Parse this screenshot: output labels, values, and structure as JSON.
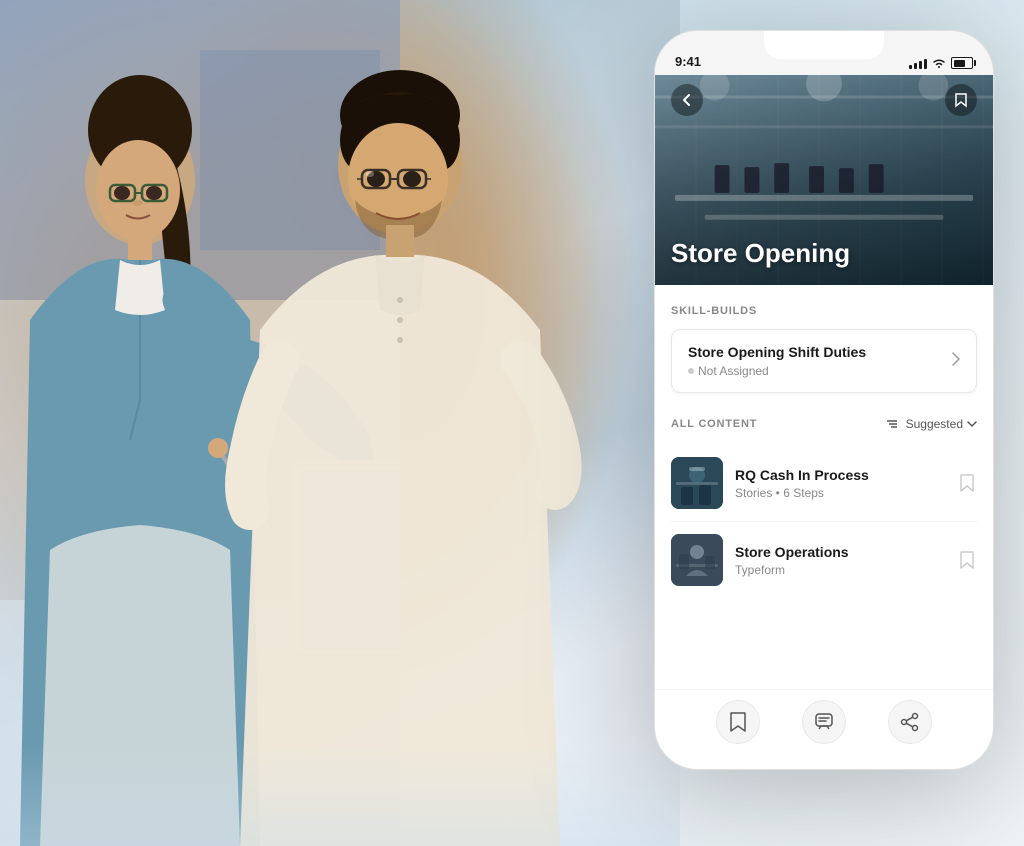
{
  "background": {
    "gradient_start": "#b0c8dc",
    "gradient_end": "#e8f0f5"
  },
  "phone": {
    "status_bar": {
      "time": "9:41",
      "signal_strength": 4,
      "wifi": true,
      "battery_percent": 70
    },
    "hero": {
      "title": "Store Opening",
      "back_label": "back",
      "bookmark_label": "bookmark"
    },
    "skill_builds_section": {
      "label": "SKILL-BUILDS",
      "card": {
        "title": "Store Opening Shift Duties",
        "status": "Not Assigned",
        "arrow": "→"
      }
    },
    "all_content_section": {
      "label": "ALL CONTENT",
      "sort_label": "Suggested",
      "items": [
        {
          "title": "RQ Cash In Process",
          "meta": "Stories • 6 Steps",
          "type": "rq"
        },
        {
          "title": "Store Operations",
          "meta": "Typeform",
          "type": "so"
        }
      ]
    },
    "bottom_nav": {
      "bookmark_btn": "bookmark",
      "chat_btn": "chat",
      "share_btn": "share"
    }
  }
}
